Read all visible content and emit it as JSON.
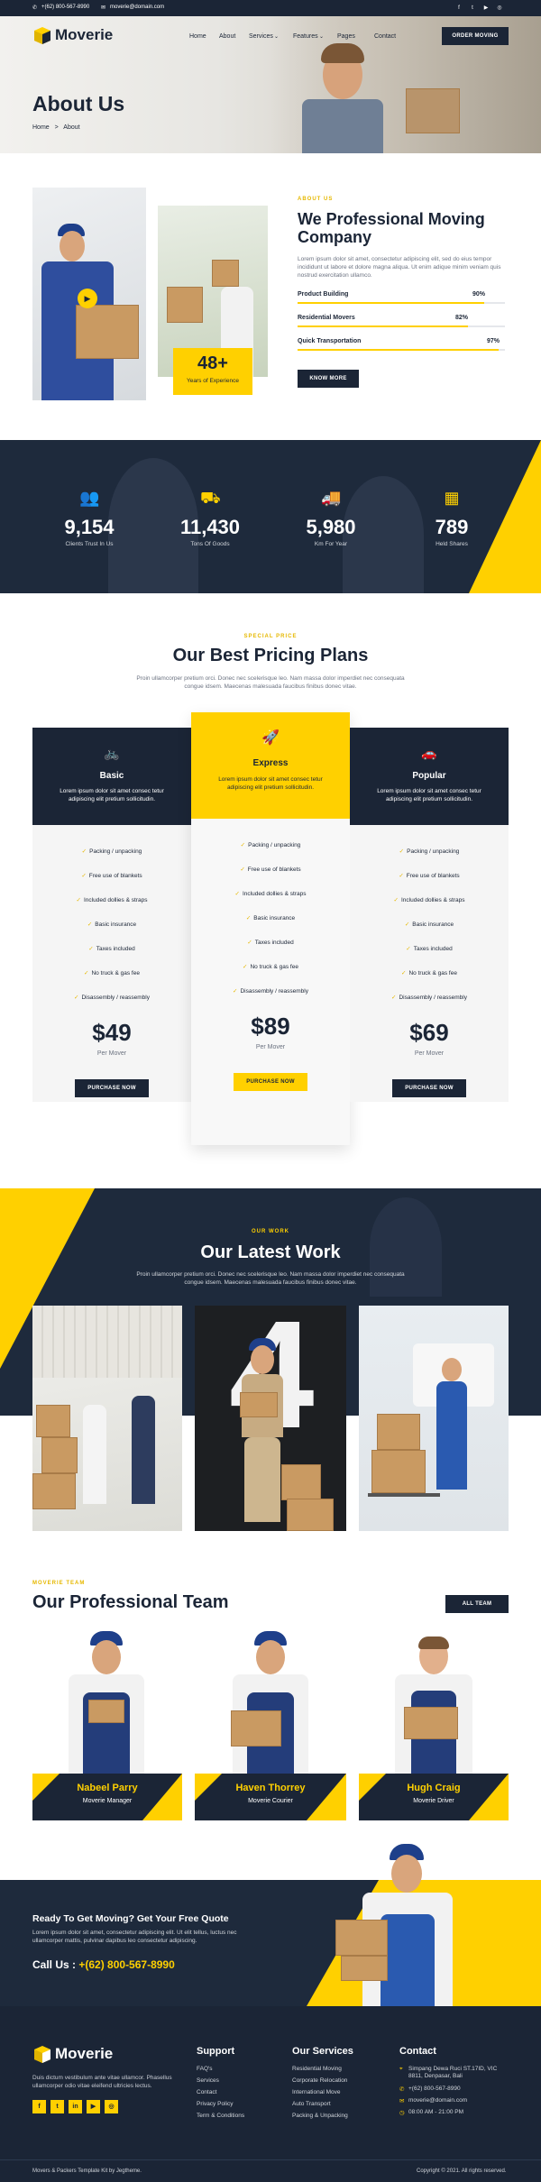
{
  "topbar": {
    "phone": "+(62) 800-567-8990",
    "email": "moverie@domain.com",
    "social": [
      "f",
      "t",
      "▶",
      "◎"
    ]
  },
  "header": {
    "logo": "Moverie",
    "nav": [
      "Home",
      "About",
      "Services",
      "Features",
      "Pages",
      "Contact"
    ],
    "cta": "ORDER MOVING"
  },
  "hero": {
    "title": "About Us",
    "breadcrumb_home": "Home",
    "breadcrumb_sep": ">",
    "breadcrumb_current": "About"
  },
  "about": {
    "tag": "ABOUT US",
    "title_line1": "We Professional Moving",
    "title_line2": "Company",
    "text": "Lorem ipsum dolor sit amet, consectetur adipiscing elit, sed do eius tempor incididunt ut labore et dolore magna aliqua. Ut enim adique minim veniam quis nostrud exercitation ullamco.",
    "years_num": "48+",
    "years_label": "Years of Experience",
    "bars": [
      {
        "label": "Product Building",
        "value": "90%",
        "pct": 90
      },
      {
        "label": "Residential Movers",
        "value": "82%",
        "pct": 82
      },
      {
        "label": "Quick Transportation",
        "value": "97%",
        "pct": 97
      }
    ],
    "button": "KNOW MORE"
  },
  "stats": [
    {
      "icon": "users-icon",
      "glyph": "👥",
      "num": "9,154",
      "label": "Clients Trust In Us"
    },
    {
      "icon": "hand-truck-icon",
      "glyph": "⛟",
      "num": "11,430",
      "label": "Tons Of Goods"
    },
    {
      "icon": "truck-icon",
      "glyph": "🚚",
      "num": "5,980",
      "label": "Km For Year"
    },
    {
      "icon": "boxes-icon",
      "glyph": "▦",
      "num": "789",
      "label": "Held Shares"
    }
  ],
  "pricing": {
    "tag": "SPECIAL PRICE",
    "title": "Our Best Pricing Plans",
    "subtitle_line1": "Proin ullamcorper pretium orci. Donec nec scelerisque leo. Nam massa dolor imperdiet nec consequata",
    "subtitle_line2": "congue idsem. Maecenas malesuada faucibus finibus donec vitae.",
    "plans": [
      {
        "name": "Basic",
        "icon": "bicycle-icon",
        "glyph": "🚲",
        "desc": "Lorem ipsum dolor sit amet consec tetur adipiscing elit pretium sollicitudin.",
        "features": [
          "Packing / unpacking",
          "Free use of blankets",
          "Included dollies & straps",
          "Basic insurance",
          "Taxes included",
          "No truck & gas fee",
          "Disassembly / reassembly"
        ],
        "price": "$49",
        "per": "Per Mover",
        "button": "PURCHASE NOW"
      },
      {
        "name": "Express",
        "icon": "rocket-icon",
        "glyph": "🚀",
        "desc": "Lorem ipsum dolor sit amet consec tetur adipiscing elit pretium sollicitudin.",
        "features": [
          "Packing / unpacking",
          "Free use of blankets",
          "Included dollies & straps",
          "Basic insurance",
          "Taxes included",
          "No truck & gas fee",
          "Disassembly / reassembly"
        ],
        "price": "$89",
        "per": "Per Mover",
        "button": "PURCHASE NOW"
      },
      {
        "name": "Popular",
        "icon": "car-icon",
        "glyph": "🚗",
        "desc": "Lorem ipsum dolor sit amet consec tetur adipiscing elit pretium sollicitudin.",
        "features": [
          "Packing / unpacking",
          "Free use of blankets",
          "Included dollies & straps",
          "Basic insurance",
          "Taxes included",
          "No truck & gas fee",
          "Disassembly / reassembly"
        ],
        "price": "$69",
        "per": "Per Mover",
        "button": "PURCHASE NOW"
      }
    ]
  },
  "work": {
    "tag": "OUR WORK",
    "title": "Our Latest Work",
    "subtitle_line1": "Proin ullamcorper pretium orci. Donec nec scelerisque leo. Nam massa dolor imperdiet nec consequata",
    "subtitle_line2": "congue idsem. Maecenas malesuada faucibus finibus donec vitae.",
    "big_number": "4"
  },
  "team": {
    "tag": "MOVERIE TEAM",
    "title": "Our Professional Team",
    "button": "ALL TEAM",
    "members": [
      {
        "name": "Nabeel Parry",
        "role": "Moverie Manager"
      },
      {
        "name": "Haven Thorrey",
        "role": "Moverie Courier"
      },
      {
        "name": "Hugh Craig",
        "role": "Moverie Driver"
      }
    ]
  },
  "cta": {
    "title": "Ready To Get Moving? Get Your Free Quote",
    "text_line1": "Lorem ipsum dolor sit amet, consectetur adipiscing elit. Ut elit tellus, luctus nec",
    "text_line2": "ullamcorper mattis, pulvinar dapibus leo consectetur adipiscing.",
    "call_label": "Call Us :",
    "call_number": "+(62) 800-567-8990"
  },
  "footer": {
    "logo": "Moverie",
    "about_line1": "Duis dictum vestibulum ante vitae ullamcor. Phasellus",
    "about_line2": "ullamcorper odio vitae eleifend ultricies lectus.",
    "social": [
      "f",
      "t",
      "in",
      "▶",
      "◎"
    ],
    "support_title": "Support",
    "support": [
      "FAQ's",
      "Services",
      "Contact",
      "Privacy Policy",
      "Term & Conditions"
    ],
    "services_title": "Our Services",
    "services": [
      "Residential Moving",
      "Corporate Relocation",
      "International Move",
      "Auto Transport",
      "Packing & Unpacking"
    ],
    "contact_title": "Contact",
    "contact": [
      {
        "icon": "map-pin-icon",
        "glyph": "⌖",
        "text": "Simpang Dewa Ruci ST.17ID, VIC 8811, Denpasar, Bali"
      },
      {
        "icon": "phone-icon",
        "glyph": "✆",
        "text": "+(62) 800-567-8990"
      },
      {
        "icon": "mail-icon",
        "glyph": "✉",
        "text": "moverie@domain.com"
      },
      {
        "icon": "clock-icon",
        "glyph": "◷",
        "text": "08:00 AM - 21:00 PM"
      }
    ],
    "copy_left": "Movers & Packers Template Kit by Jegtheme.",
    "copy_right": "Copyright © 2021. All rights reserved.",
    "accent": "#ffd000",
    "navy": "#1b2536"
  }
}
